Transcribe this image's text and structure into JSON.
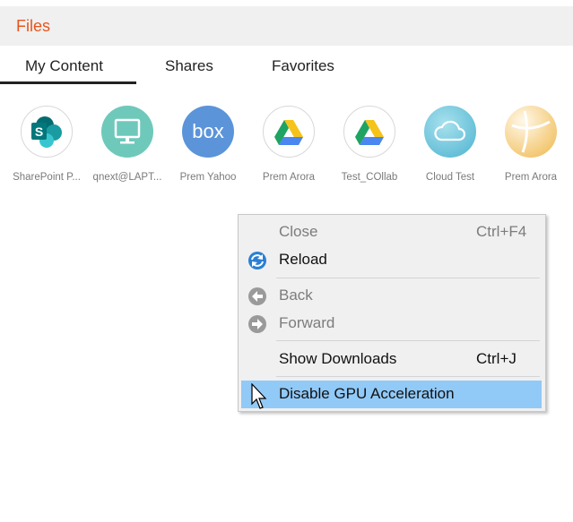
{
  "header": {
    "title": "Files"
  },
  "tabs": [
    {
      "label": "My Content",
      "active": true
    },
    {
      "label": "Shares",
      "active": false
    },
    {
      "label": "Favorites",
      "active": false
    }
  ],
  "accounts": [
    {
      "label": "SharePoint P...",
      "icon": "sharepoint-icon"
    },
    {
      "label": "qnext@LAPT...",
      "icon": "computer-icon"
    },
    {
      "label": "Prem Yahoo",
      "icon": "box-icon"
    },
    {
      "label": "Prem Arora",
      "icon": "google-drive-icon"
    },
    {
      "label": "Test_COllab",
      "icon": "google-drive-icon"
    },
    {
      "label": "Cloud Test",
      "icon": "cloud-icon"
    },
    {
      "label": "Prem Arora",
      "icon": "beach-ball-icon"
    }
  ],
  "context_menu": {
    "items": [
      {
        "label": "Close",
        "shortcut": "Ctrl+F4",
        "enabled": false
      },
      {
        "label": "Reload",
        "shortcut": "",
        "enabled": true,
        "icon": "reload-icon"
      },
      {
        "label": "Back",
        "shortcut": "",
        "enabled": false,
        "icon": "back-arrow-icon"
      },
      {
        "label": "Forward",
        "shortcut": "",
        "enabled": false,
        "icon": "forward-arrow-icon"
      },
      {
        "label": "Show Downloads",
        "shortcut": "Ctrl+J",
        "enabled": true
      },
      {
        "label": "Disable GPU Acceleration",
        "shortcut": "",
        "enabled": true,
        "highlighted": true
      }
    ]
  },
  "colors": {
    "brand": "#e8541e",
    "highlight": "#91c9f7"
  }
}
